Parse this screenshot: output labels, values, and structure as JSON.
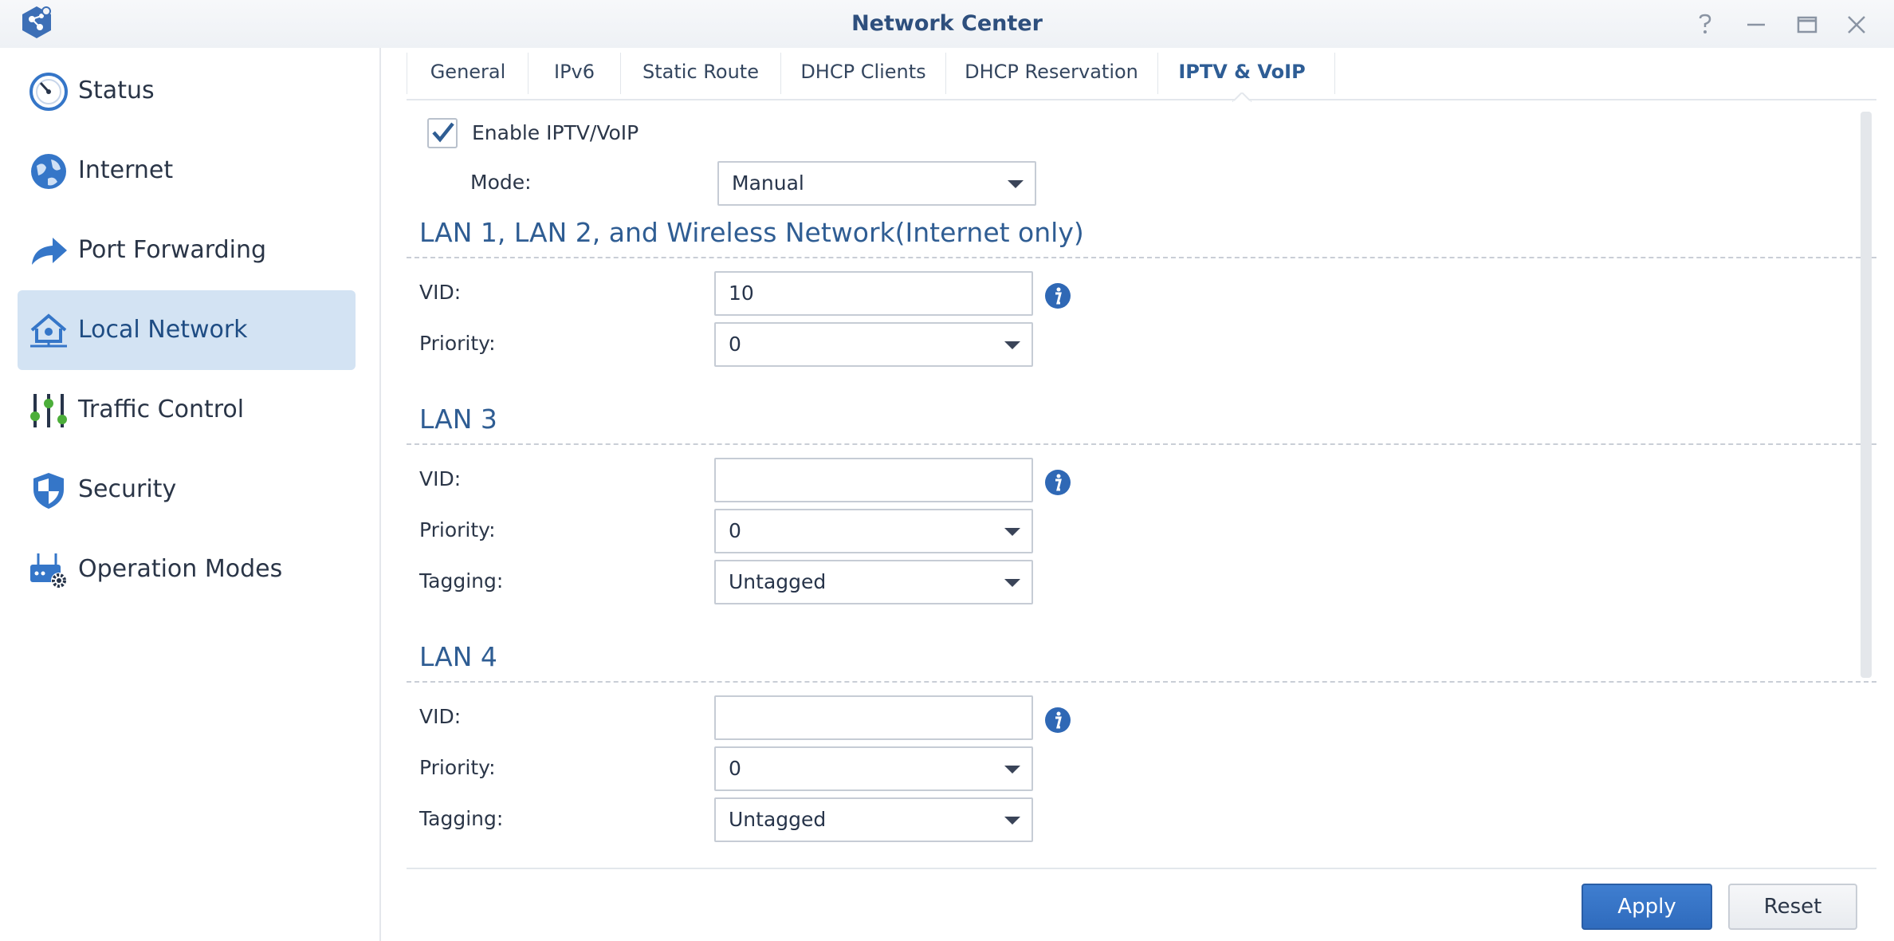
{
  "window": {
    "title": "Network Center",
    "controls": [
      "help-icon",
      "minimize-icon",
      "maximize-icon",
      "close-icon"
    ]
  },
  "sidebar": {
    "items": [
      {
        "label": "Status",
        "icon": "gauge-icon"
      },
      {
        "label": "Internet",
        "icon": "globe-icon"
      },
      {
        "label": "Port Forwarding",
        "icon": "forward-arrow-icon"
      },
      {
        "label": "Local Network",
        "icon": "house-network-icon",
        "active": true
      },
      {
        "label": "Traffic Control",
        "icon": "sliders-icon"
      },
      {
        "label": "Security",
        "icon": "shield-icon"
      },
      {
        "label": "Operation Modes",
        "icon": "router-gear-icon"
      }
    ]
  },
  "tabs": [
    {
      "label": "General"
    },
    {
      "label": "IPv6"
    },
    {
      "label": "Static Route"
    },
    {
      "label": "DHCP Clients"
    },
    {
      "label": "DHCP Reservation"
    },
    {
      "label": "IPTV & VoIP",
      "active": true
    }
  ],
  "form": {
    "enable_label": "Enable IPTV/VoIP",
    "enable_checked": true,
    "mode_label": "Mode:",
    "mode_value": "Manual",
    "sections": [
      {
        "title": "LAN 1, LAN 2, and Wireless Network(Internet only)",
        "vid_label": "VID:",
        "vid_value": "10",
        "priority_label": "Priority:",
        "priority_value": "0"
      },
      {
        "title": "LAN 3",
        "vid_label": "VID:",
        "vid_value": "",
        "priority_label": "Priority:",
        "priority_value": "0",
        "tagging_label": "Tagging:",
        "tagging_value": "Untagged"
      },
      {
        "title": "LAN 4",
        "vid_label": "VID:",
        "vid_value": "",
        "priority_label": "Priority:",
        "priority_value": "0",
        "tagging_label": "Tagging:",
        "tagging_value": "Untagged"
      }
    ]
  },
  "footer": {
    "apply_label": "Apply",
    "reset_label": "Reset"
  },
  "colors": {
    "accent": "#2f5d93",
    "active_bg": "#d3e3f3",
    "apply_bg": "#3a77c9",
    "icon_blue": "#3576c8",
    "icon_green": "#4cae3a"
  }
}
